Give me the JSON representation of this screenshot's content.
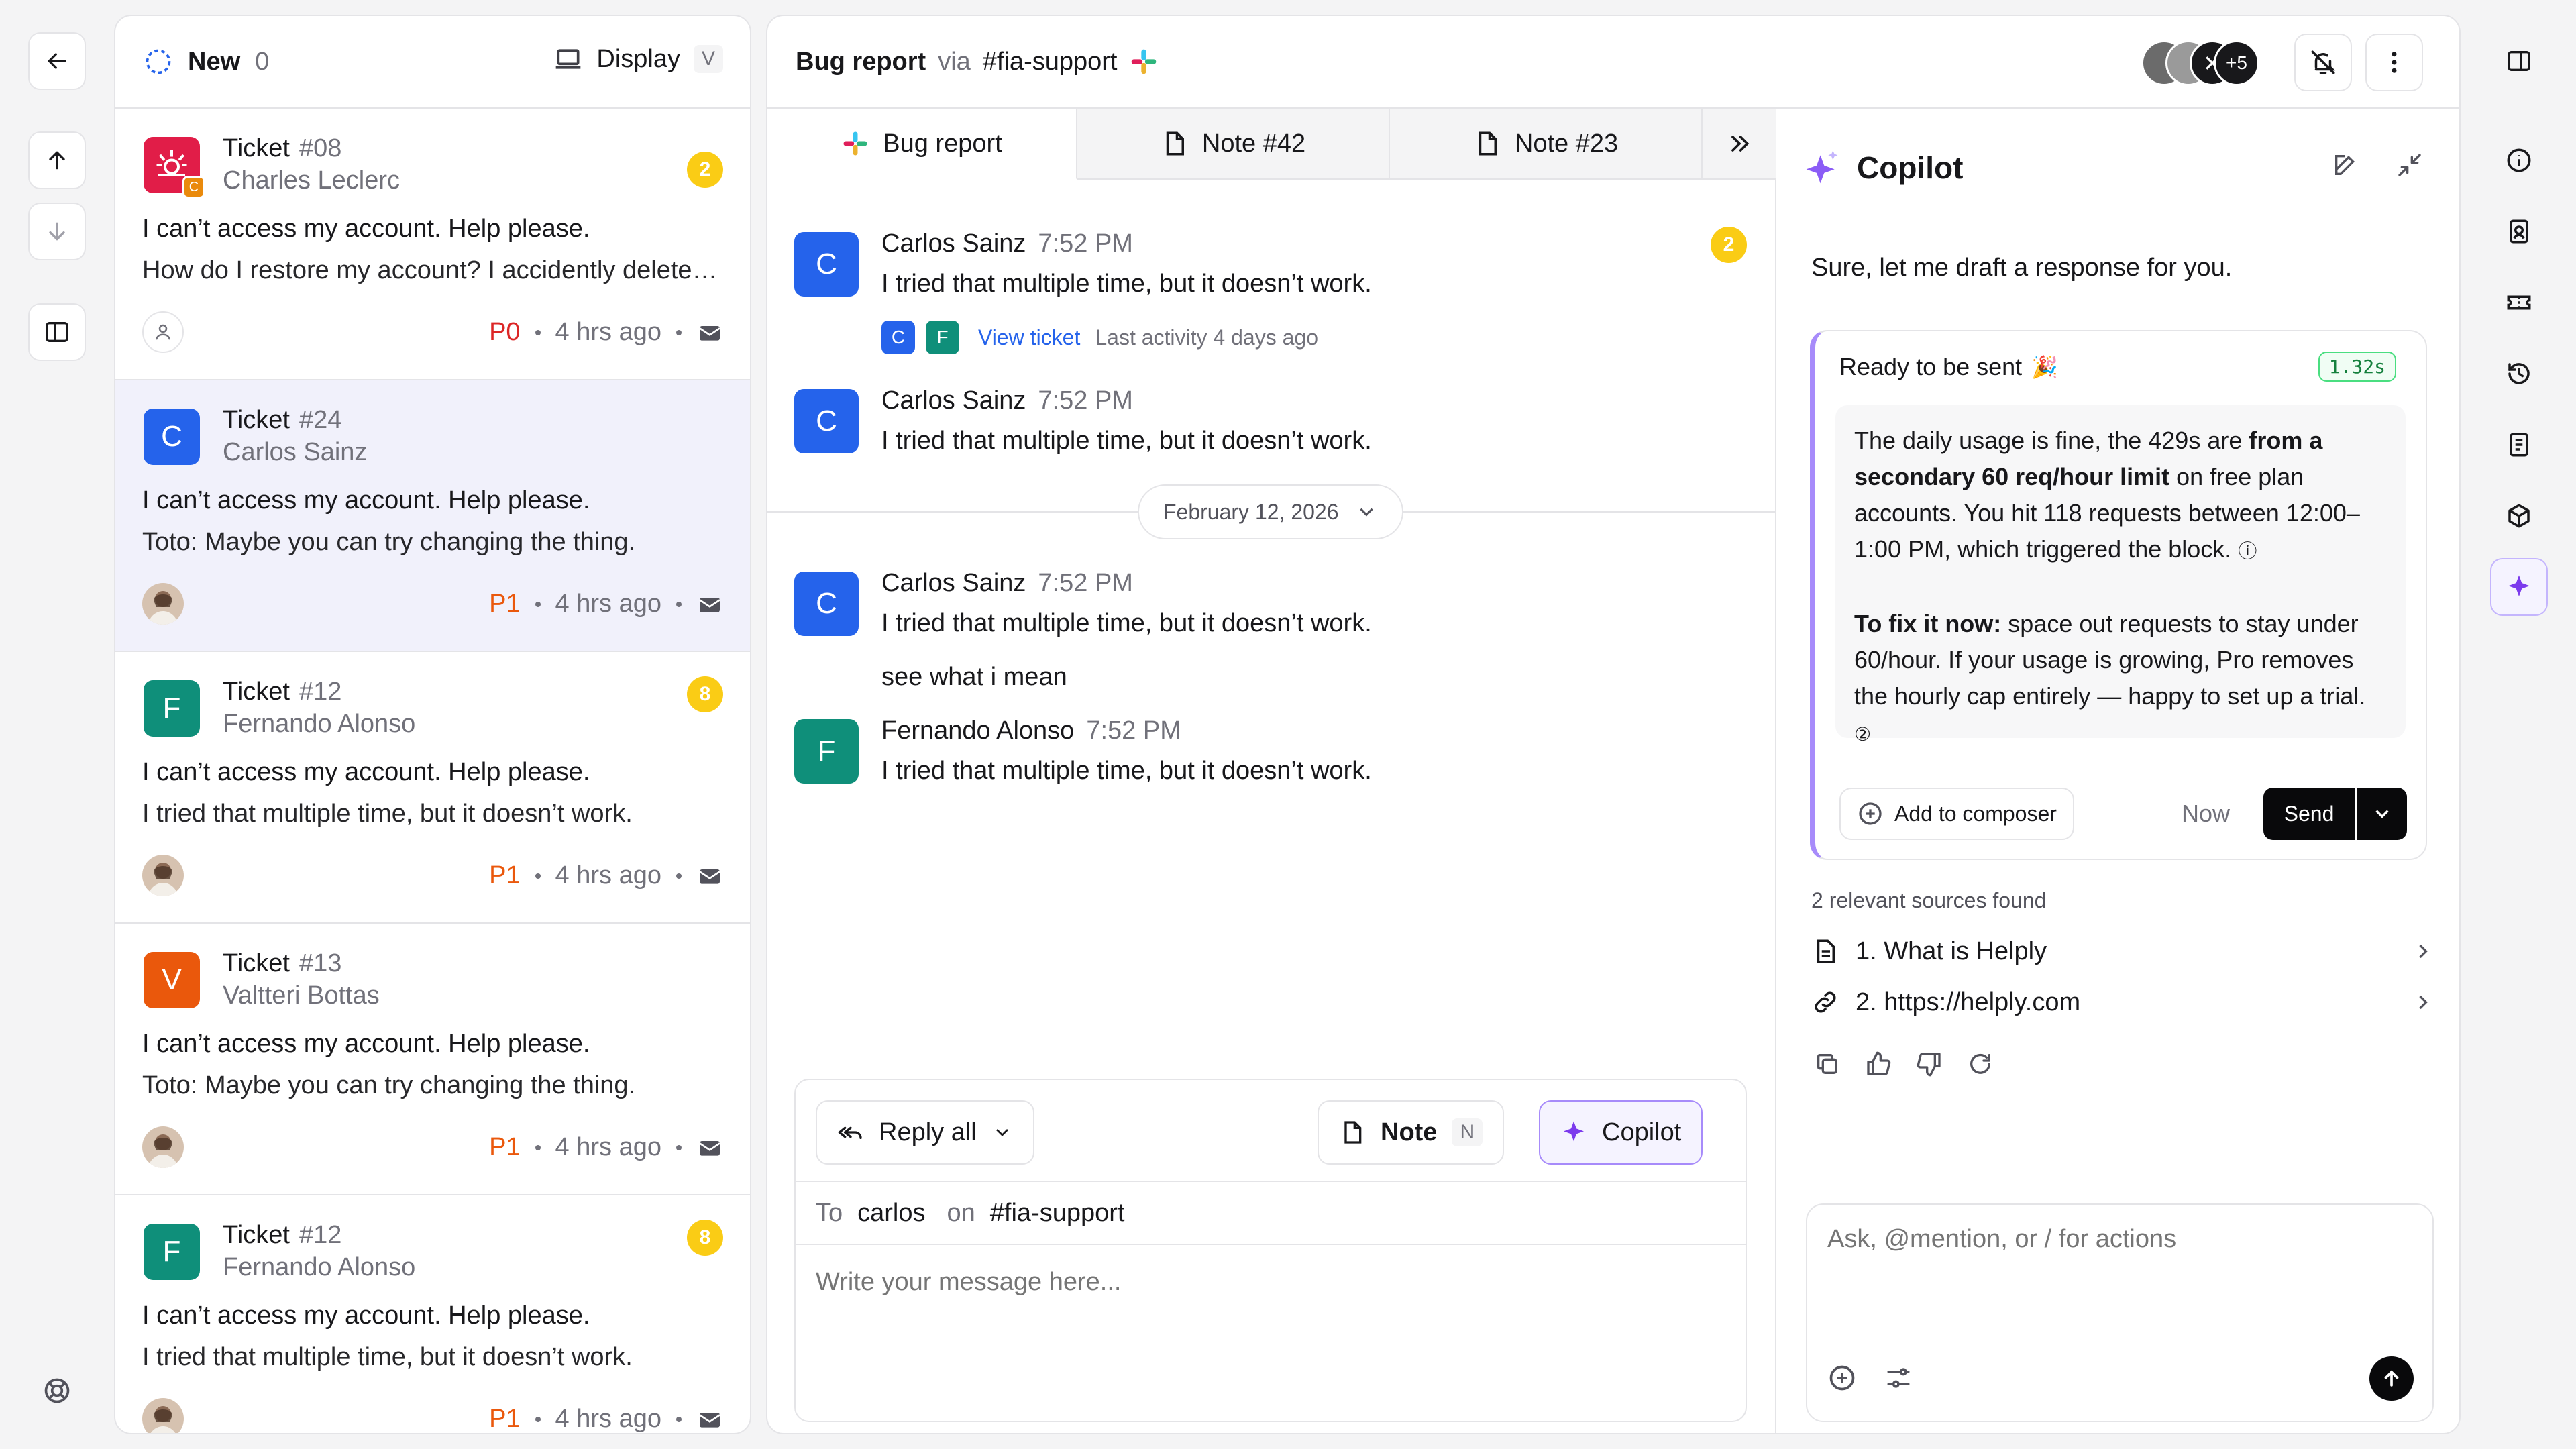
{
  "nav": {
    "back": "back",
    "up": "up",
    "down": "down",
    "panel": "panel",
    "help": "help"
  },
  "list": {
    "status_label": "New",
    "status_count": "0",
    "display_label": "Display",
    "display_key": "V",
    "tickets": [
      {
        "label": "Ticket",
        "num": "#08",
        "name": "Charles Leclerc",
        "line1": "I can’t access my account. Help please.",
        "line2": "How do I restore my account? I accidently deleted it",
        "badge": "2",
        "priority": "P0",
        "time": "4 hrs ago",
        "avatar_letter": "",
        "avatar_color": "#e11d48",
        "sub_letter": "C"
      },
      {
        "label": "Ticket",
        "num": "#24",
        "name": "Carlos Sainz",
        "line1": "I can’t access my account. Help please.",
        "line2": "Toto: Maybe you can try changing the thing.",
        "badge": "",
        "priority": "P1",
        "time": "4 hrs ago",
        "avatar_letter": "C",
        "avatar_color": "#2563eb"
      },
      {
        "label": "Ticket",
        "num": "#12",
        "name": "Fernando Alonso",
        "line1": "I can’t access my account. Help please.",
        "line2": "I tried that multiple time, but it doesn’t work.",
        "badge": "8",
        "priority": "P1",
        "time": "4 hrs ago",
        "avatar_letter": "F",
        "avatar_color": "#0f8f7a"
      },
      {
        "label": "Ticket",
        "num": "#13",
        "name": "Valtteri Bottas",
        "line1": "I can’t access my account. Help please.",
        "line2": "Toto: Maybe you can try changing the thing.",
        "badge": "",
        "priority": "P1",
        "time": "4 hrs ago",
        "avatar_letter": "V",
        "avatar_color": "#ea580c"
      },
      {
        "label": "Ticket",
        "num": "#12",
        "name": "Fernando Alonso",
        "line1": "I can’t access my account. Help please.",
        "line2": "I tried that multiple time, but it doesn’t work.",
        "badge": "8",
        "priority": "P1",
        "time": "4 hrs ago",
        "avatar_letter": "F",
        "avatar_color": "#0f8f7a"
      }
    ]
  },
  "conversation": {
    "title": "Bug report",
    "via": "via",
    "channel": "#fia-support",
    "participants_more": "+5",
    "tabs": [
      "Bug report",
      "Note #42",
      "Note #23"
    ],
    "messages": [
      {
        "name": "Carlos Sainz",
        "time": "7:52 PM",
        "text": "I tried that multiple time, but it doesn’t work.",
        "avatar": "C"
      },
      {
        "name": "Carlos Sainz",
        "time": "7:52 PM",
        "text": "I tried that multiple time, but it doesn’t work.",
        "avatar": "C"
      },
      {
        "name": "Carlos Sainz",
        "time": "7:52 PM",
        "text": "I tried that multiple time, but it doesn’t work.",
        "avatar": "C",
        "followup": "see what i mean"
      },
      {
        "name": "Fernando Alonso",
        "time": "7:52 PM",
        "text": "I tried that multiple time, but it doesn’t work.",
        "avatar": "F"
      }
    ],
    "msg_badge": "2",
    "view_ticket": "View ticket",
    "last_activity": "Last activity 4 days ago",
    "date_divider": "February 12, 2026",
    "composer": {
      "reply_label": "Reply all",
      "note_label": "Note",
      "note_key": "N",
      "copilot_label": "Copilot",
      "to_label": "To",
      "to_value": "carlos",
      "on_label": "on",
      "on_value": "#fia-support",
      "placeholder": "Write your message here..."
    }
  },
  "copilot": {
    "title": "Copilot",
    "intro": "Sure, let me draft a response for you.",
    "card_status": "Ready to be sent",
    "card_emoji": "🎉",
    "latency": "1.32s",
    "p1_a": "The daily usage is fine, the 429s are ",
    "p1_b": "from a secondary 60 req/hour limit",
    "p1_c": " on free plan accounts. You hit 118 requests between 12:00–1:00 PM, which triggered the block.",
    "p2_a": "To fix it now:",
    "p2_b": " space out requests to stay under 60/hour. If your usage is growing, Pro removes the hourly cap entirely — happy to set up a trial.",
    "add_label": "Add to composer",
    "now_label": "Now",
    "send_label": "Send",
    "sources_title": "2 relevant sources found",
    "sources": [
      "1. What is Helply",
      "2. https://helply.com"
    ],
    "input_placeholder": "Ask, @mention, or / for actions"
  }
}
